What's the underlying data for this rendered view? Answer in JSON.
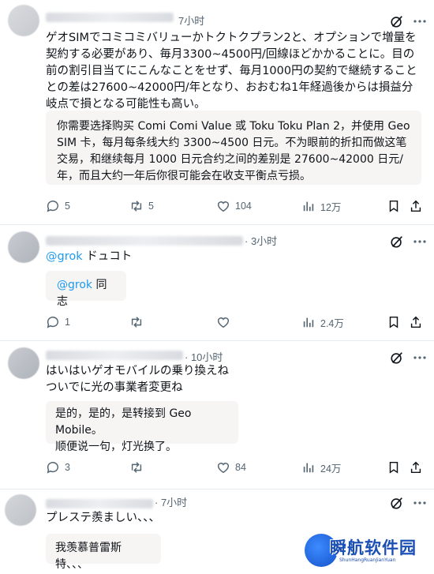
{
  "tweets": [
    {
      "time": "7小时",
      "text": "ゲオSIMでコミコミバリューかトクトクプラン2と、オプションで増量を契約する必要があり、毎月3300~4500円/回線ほどかかることに。目の前の割引目当てにこんなことをせず、毎月1000円の契約で継続することとの差は27600~42000円/年となり、おおむね1年経過後からは損益分岐点で損となる可能性も高い。",
      "translation": "你需要选择购买 Comi Comi Value 或 Toku Toku Plan 2，并使用 Geo SIM 卡，每月每条线大约 3300~4500 日元。不为眼前的折扣而做这笔交易，和继续每月 1000 日元合约之间的差别是 27600~42000 日元/年，而且大约一年后你很可能会在收支平衡点亏损。",
      "replies": "5",
      "reposts": "5",
      "likes": "104",
      "views": "12万"
    },
    {
      "time": "· 3小时",
      "mention": "@grok",
      "text_after_mention": " ドュコト",
      "translation_mention": "@grok",
      "translation_after": " 同志",
      "replies": "1",
      "reposts": "",
      "likes": "",
      "views": "2.4万"
    },
    {
      "time": "· 10小时",
      "line1": "はいはいゲオモバイルの乗り換えね",
      "line2": "ついでに光の事業者変更ね",
      "translation_line1": "是的，是的，是转接到 Geo Mobile。",
      "translation_line2": "顺便说一句，灯光换了。",
      "replies": "3",
      "reposts": "",
      "likes": "84",
      "views": "24万"
    },
    {
      "time": "· 7小时",
      "text": "プレステ羨ましい、、、",
      "translation": "我羡慕普雷斯特、、、"
    }
  ],
  "watermark": {
    "title": "瞬航软件园",
    "subtitle": "ShunHangRuanJianYuan"
  },
  "colors": {
    "accent": "#1d9bf0",
    "muted": "#536471",
    "box": "#f7f4f4"
  }
}
